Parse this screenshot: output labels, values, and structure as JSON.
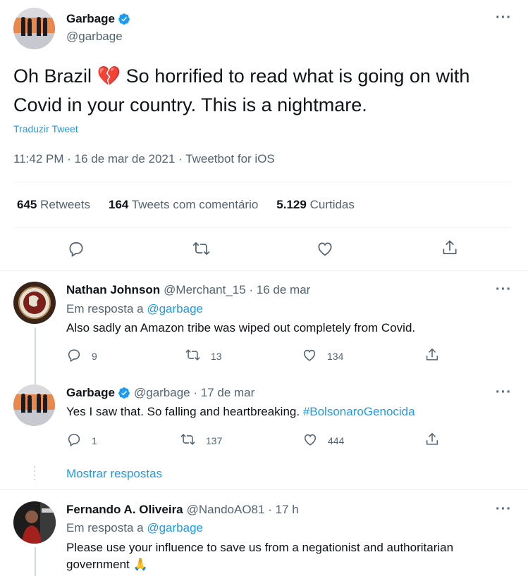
{
  "main": {
    "author_name": "Garbage",
    "author_handle": "@garbage",
    "text_before_emoji": "Oh Brazil ",
    "emoji": "💔",
    "text_after_emoji": " So horrified to read what is going on with Covid in your country. This is a nightmare.",
    "translate_label": "Traduzir Tweet",
    "time": "11:42 PM",
    "sep1": " · ",
    "date": "16 de mar de 2021",
    "sep2": " · ",
    "source": "Tweetbot for iOS",
    "stats": [
      {
        "count": "645",
        "label": "Retweets"
      },
      {
        "count": "164",
        "label": "Tweets com comentário"
      },
      {
        "count": "5.129",
        "label": "Curtidas"
      }
    ],
    "more": "···"
  },
  "replies": [
    {
      "name": "Nathan Johnson",
      "meta": "@Merchant_15 · 16 de mar",
      "in_reply_prefix": "Em resposta a ",
      "in_reply_handle": "@garbage",
      "text": "Also sadly an Amazon tribe was wiped out completely from Covid.",
      "reply_count": "9",
      "retweet_count": "13",
      "like_count": "134",
      "more": "···"
    },
    {
      "name": "Garbage",
      "meta": "@garbage · 17 de mar",
      "text": "Yes I saw that. So falling and heartbreaking. ",
      "hashtag": "#BolsonaroGenocida",
      "reply_count": "1",
      "retweet_count": "137",
      "like_count": "444",
      "more": "···"
    },
    {
      "name": "Fernando A. Oliveira",
      "meta": "@NandoAO81 · 17 h",
      "in_reply_prefix": "Em resposta a ",
      "in_reply_handle": "@garbage",
      "text": "Please use your influence to save us from a negationist and authoritarian government ",
      "emoji": "🙏",
      "more": "···"
    }
  ],
  "show_replies_label": "Mostrar respostas",
  "colors": {
    "accent": "#1d9bf0",
    "text": "#0f1419",
    "muted": "#536471",
    "divider": "#eff3f4"
  },
  "icons": [
    "verified-badge-icon",
    "more-icon",
    "reply-icon",
    "retweet-icon",
    "like-icon",
    "share-icon"
  ]
}
